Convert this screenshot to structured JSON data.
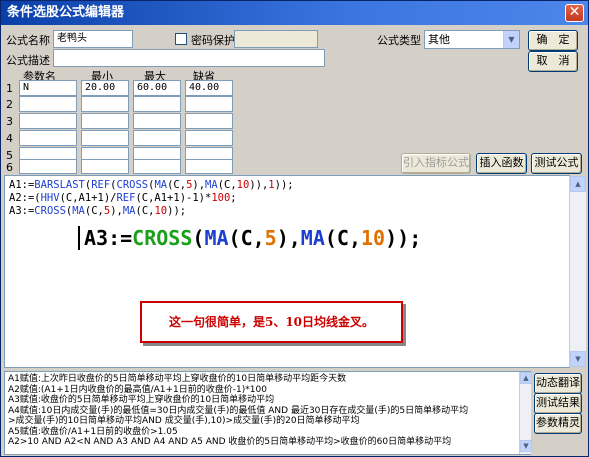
{
  "window": {
    "title": "条件选股公式编辑器",
    "close_glyph": "✕"
  },
  "form": {
    "name_label": "公式名称",
    "name_value": "老鸭头",
    "password_label": "密码保护",
    "desc_label": "公式描述",
    "desc_value": "",
    "type_label": "公式类型",
    "type_value": "其他"
  },
  "buttons": {
    "ok": "确　定",
    "cancel": "取　消",
    "import": "引入指标公式",
    "insert_func": "插入函数",
    "test_formula": "测试公式",
    "dynamic_translate": "动态翻译",
    "test_result": "测试结果",
    "param_wizard": "参数精灵"
  },
  "params": {
    "headers": {
      "name": "参数名",
      "min": "最小",
      "max": "最大",
      "default": "缺省"
    },
    "rows": [
      {
        "index": "1",
        "name": "N",
        "min": "20.00",
        "max": "60.00",
        "default": "40.00"
      },
      {
        "index": "2",
        "name": "",
        "min": "",
        "max": "",
        "default": ""
      },
      {
        "index": "3",
        "name": "",
        "min": "",
        "max": "",
        "default": ""
      },
      {
        "index": "4",
        "name": "",
        "min": "",
        "max": "",
        "default": ""
      },
      {
        "index": "5",
        "name": "",
        "min": "",
        "max": "",
        "default": ""
      },
      {
        "index": "6",
        "name": "",
        "min": "",
        "max": "",
        "default": ""
      }
    ]
  },
  "code": {
    "line1_parts": [
      "A1:=",
      "BARSLAST",
      "(",
      "REF",
      "(",
      "CROSS",
      "(",
      "MA",
      "(C,",
      "5",
      "),",
      "MA",
      "(C,",
      "10",
      ")),",
      "1",
      "));"
    ],
    "line2_parts": [
      "A2:=(",
      "HHV",
      "(C,A1+1)/",
      "REF",
      "(C,A1+1)-1)*",
      "100",
      ";"
    ],
    "line3_parts": [
      "A3:=",
      "CROSS",
      "(",
      "MA",
      "(C,",
      "5",
      "),",
      "MA",
      "(C,",
      "10",
      "));"
    ],
    "zoom_parts": [
      "A3:=",
      "CROSS",
      "(",
      "MA",
      "(C,",
      "5",
      "),",
      "MA",
      "(C,",
      "10",
      "));"
    ]
  },
  "callout": {
    "text": "这一句很简单，是5、10日均线金叉。"
  },
  "description": [
    "A1赋值:上次昨日收盘价的5日简单移动平均上穿收盘价的10日简单移动平均距今天数",
    "A2赋值:(A1+1日内收盘价的最高值/A1+1日前的收盘价-1)*100",
    "A3赋值:收盘价的5日简单移动平均上穿收盘价的10日简单移动平均",
    "A4赋值:10日内成交量(手)的最低值=30日内成交量(手)的最低值 AND 最近30日存在成交量(手)的5日简单移动平均",
    ">成交量(手)的10日简单移动平均AND 成交量(手),10)>成交量(手)的20日简单移动平均",
    "A5赋值:收盘价/A1+1日前的收盘价>1.05",
    "A2>10 AND A2<N AND A3 AND A4 AND A5 AND 收盘价的5日简单移动平均>收盘价的60日简单移动平均"
  ],
  "colors": {
    "function": "#1d3fd0",
    "number": "#c80000",
    "callout": "#cc0000",
    "title_bar": "#0a3fa8"
  }
}
